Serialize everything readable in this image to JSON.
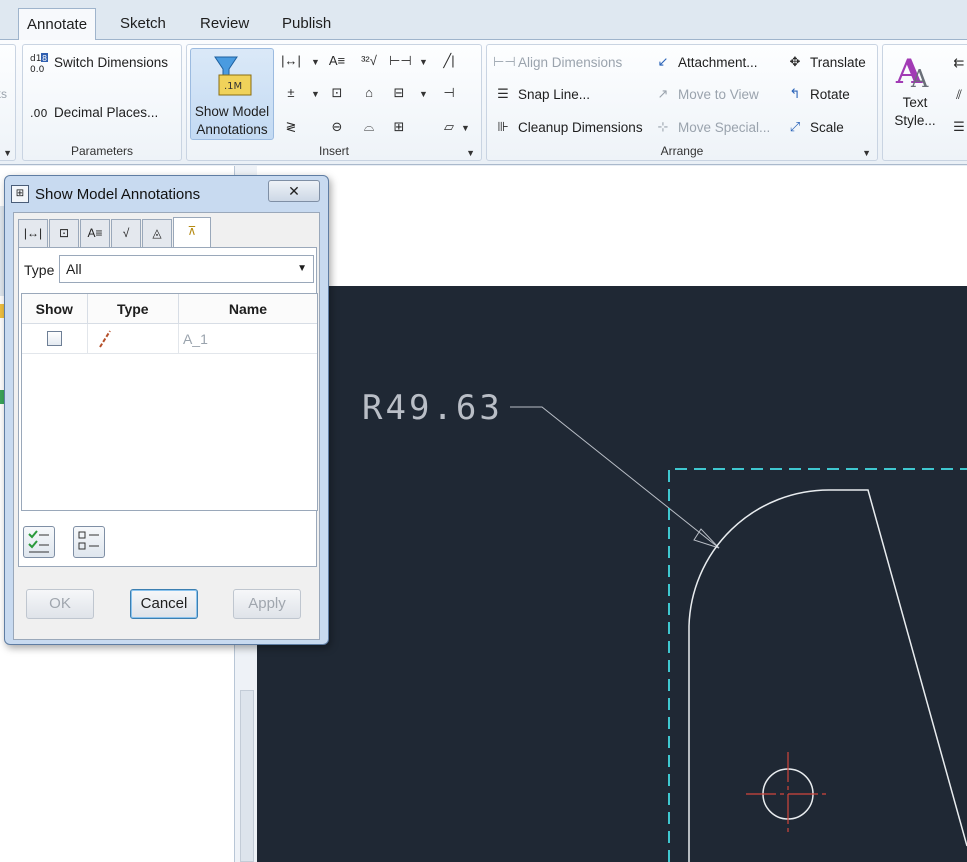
{
  "ribbon": {
    "tabs": [
      {
        "label": "Annotate",
        "active": true
      },
      {
        "label": "Sketch"
      },
      {
        "label": "Review"
      },
      {
        "label": "Publish"
      }
    ],
    "left_stub": "ks",
    "parameters": {
      "title": "Parameters",
      "switch_dimensions": "Switch Dimensions",
      "decimal_places": "Decimal Places..."
    },
    "insert": {
      "title": "Insert",
      "show_model_annotations_line1": "Show Model",
      "show_model_annotations_line2": "Annotations"
    },
    "arrange": {
      "title": "Arrange",
      "align_dimensions": "Align Dimensions",
      "snap_line": "Snap Line...",
      "cleanup_dimensions": "Cleanup Dimensions",
      "attachment": "Attachment...",
      "move_to_view": "Move to View",
      "move_special": "Move Special...",
      "translate": "Translate",
      "rotate": "Rotate",
      "scale": "Scale"
    },
    "format": {
      "text_style_line1": "Text",
      "text_style_line2": "Style..."
    }
  },
  "dialog": {
    "title": "Show Model Annotations",
    "close_symbol": "✕",
    "type_label": "Type",
    "type_value": "All",
    "columns": [
      "Show",
      "Type",
      "Name"
    ],
    "rows": [
      {
        "show": false,
        "type_icon": "datum-axis-icon",
        "name": "A_1"
      }
    ],
    "buttons": {
      "ok": "OK",
      "cancel": "Cancel",
      "apply": "Apply"
    }
  },
  "drawing": {
    "dimension_text": "R49.63"
  },
  "colors": {
    "canvas_bg": "#1f2834",
    "dashed_border": "#3fc7cf",
    "center_mark": "#d0453c",
    "geometry": "#e8ecef"
  }
}
